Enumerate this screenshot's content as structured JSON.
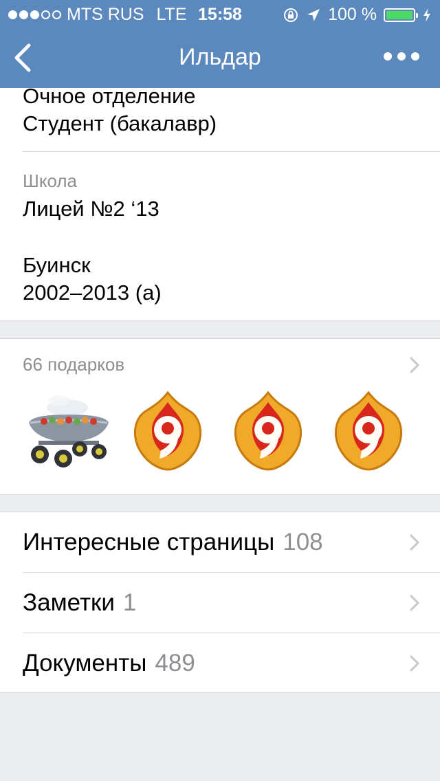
{
  "status_bar": {
    "carrier": "MTS RUS",
    "network": "LTE",
    "time": "15:58",
    "battery": "100 %"
  },
  "nav": {
    "title": "Ильдар",
    "back_icon": "chevron-left-icon",
    "more_icon": "more-dots-icon"
  },
  "education": {
    "form": "Очное отделение",
    "status": "Студент (бакалавр)",
    "school_caption": "Школа",
    "school_name": "Лицей №2 ‘13",
    "school_city": "Буинск",
    "school_years": "2002–2013 (а)"
  },
  "gifts": {
    "header": "66 подарков",
    "items": [
      {
        "icon": "grill-gift-icon"
      },
      {
        "icon": "number-nine-gift-icon"
      },
      {
        "icon": "number-nine-gift-icon"
      },
      {
        "icon": "number-nine-gift-icon"
      }
    ]
  },
  "links": [
    {
      "label": "Интересные страницы",
      "count": "108"
    },
    {
      "label": "Заметки",
      "count": "1"
    },
    {
      "label": "Документы",
      "count": "489"
    }
  ],
  "colors": {
    "nav_bar": "#5b88bd",
    "battery_fill": "#4cd964",
    "background": "#ebedf0"
  }
}
